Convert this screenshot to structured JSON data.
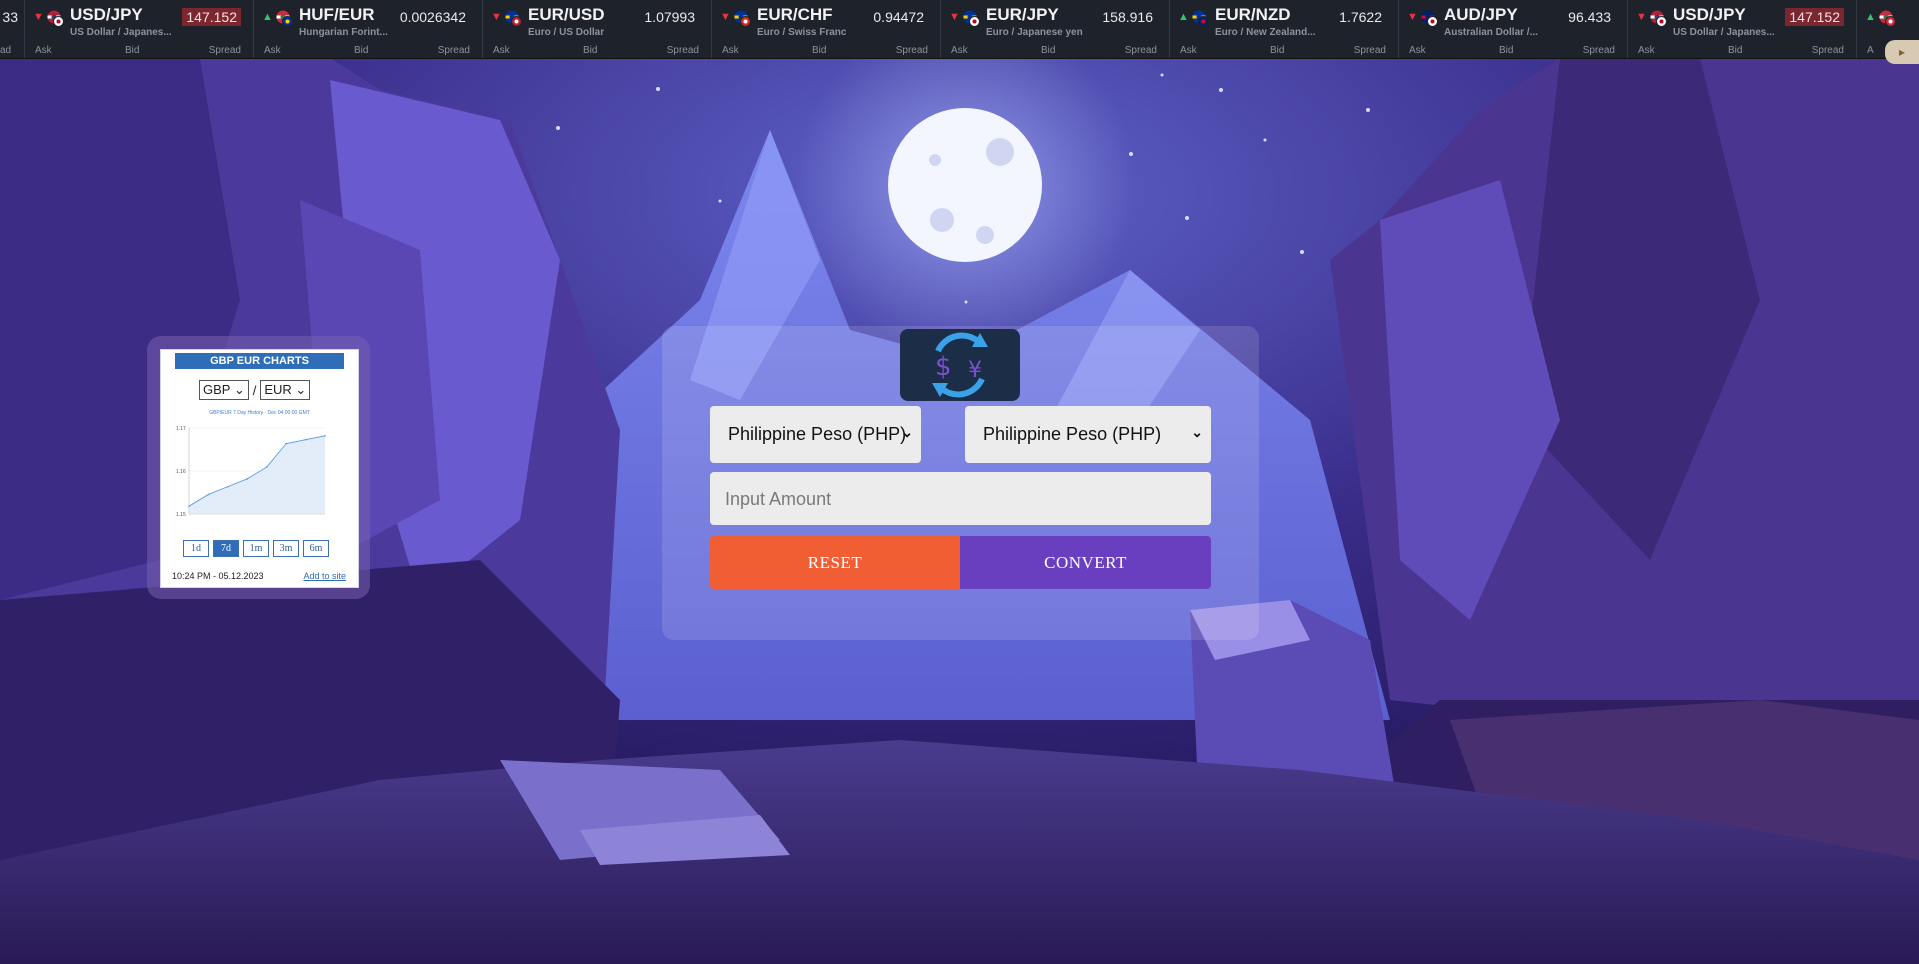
{
  "ticker": [
    {
      "id": "partial-left",
      "symbol": "",
      "name": "",
      "price": "33",
      "ask": "ad",
      "bid": "",
      "spread": ""
    },
    {
      "symbol": "USD/JPY",
      "name": "US Dollar / Japanes...",
      "price": "147.152",
      "direction": "down",
      "flags": [
        "us",
        "jp"
      ],
      "highlight": true,
      "ask": "Ask",
      "bid": "Bid",
      "spread": "Spread"
    },
    {
      "symbol": "HUF/EUR",
      "name": "Hungarian Forint...",
      "price": "0.0026342",
      "direction": "up",
      "flags": [
        "hu",
        "eu"
      ],
      "highlight": false,
      "ask": "Ask",
      "bid": "Bid",
      "spread": "Spread"
    },
    {
      "symbol": "EUR/USD",
      "name": "Euro / US Dollar",
      "price": "1.07993",
      "direction": "down",
      "flags": [
        "eu",
        "us"
      ],
      "highlight": false,
      "ask": "Ask",
      "bid": "Bid",
      "spread": "Spread"
    },
    {
      "symbol": "EUR/CHF",
      "name": "Euro / Swiss Franc",
      "price": "0.94472",
      "direction": "down",
      "flags": [
        "eu",
        "ch"
      ],
      "highlight": false,
      "ask": "Ask",
      "bid": "Bid",
      "spread": "Spread"
    },
    {
      "symbol": "EUR/JPY",
      "name": "Euro / Japanese yen",
      "price": "158.916",
      "direction": "down",
      "flags": [
        "eu",
        "jp"
      ],
      "highlight": false,
      "ask": "Ask",
      "bid": "Bid",
      "spread": "Spread"
    },
    {
      "symbol": "EUR/NZD",
      "name": "Euro / New Zealand...",
      "price": "1.7622",
      "direction": "up",
      "flags": [
        "eu",
        "nz"
      ],
      "highlight": false,
      "ask": "Ask",
      "bid": "Bid",
      "spread": "Spread"
    },
    {
      "symbol": "AUD/JPY",
      "name": "Australian Dollar /...",
      "price": "96.433",
      "direction": "down",
      "flags": [
        "au",
        "jp"
      ],
      "highlight": false,
      "ask": "Ask",
      "bid": "Bid",
      "spread": "Spread"
    },
    {
      "symbol": "USD/JPY",
      "name": "US Dollar / Japanes...",
      "price": "147.152",
      "direction": "down",
      "flags": [
        "us",
        "jp"
      ],
      "highlight": true,
      "ask": "Ask",
      "bid": "Bid",
      "spread": "Spread"
    },
    {
      "id": "partial-right",
      "symbol": "",
      "name": "",
      "price": "",
      "direction": "up",
      "flags": [
        "hu"
      ],
      "ask": "A",
      "bid": "",
      "spread": ""
    }
  ],
  "chart_widget": {
    "title": "GBP EUR CHARTS",
    "base_currency": "GBP",
    "quote_currency": "EUR",
    "separator": "/",
    "caption": "GBP/EUR 7 Day History - Dec 04 00:00 GMT",
    "ranges": [
      "1d",
      "7d",
      "1m",
      "3m",
      "6m"
    ],
    "active_range": "7d",
    "timestamp": "10:24 PM - 05.12.2023",
    "add_link": "Add to site",
    "y_ticks": [
      "1.17",
      "1.16",
      "1.15"
    ]
  },
  "chart_data": {
    "type": "area",
    "title": "GBP/EUR 7 Day History",
    "x": [
      1,
      2,
      3,
      4,
      5,
      6,
      7,
      8
    ],
    "values": [
      1.151,
      1.154,
      1.156,
      1.158,
      1.161,
      1.167,
      1.168,
      1.169
    ],
    "ylim": [
      1.149,
      1.171
    ],
    "grid": true
  },
  "converter": {
    "logo_symbols": [
      "$",
      "¥"
    ],
    "from_currency": "Philippine Peso (PHP)",
    "to_currency": "Philippine Peso (PHP)",
    "amount_value": "",
    "amount_placeholder": "Input Amount",
    "reset_label": "RESET",
    "convert_label": "CONVERT",
    "colors": {
      "reset": "#f25e34",
      "convert": "#6a3fbf",
      "logo_bg": "#1c2d48",
      "accent": "#3aa3e8"
    }
  }
}
